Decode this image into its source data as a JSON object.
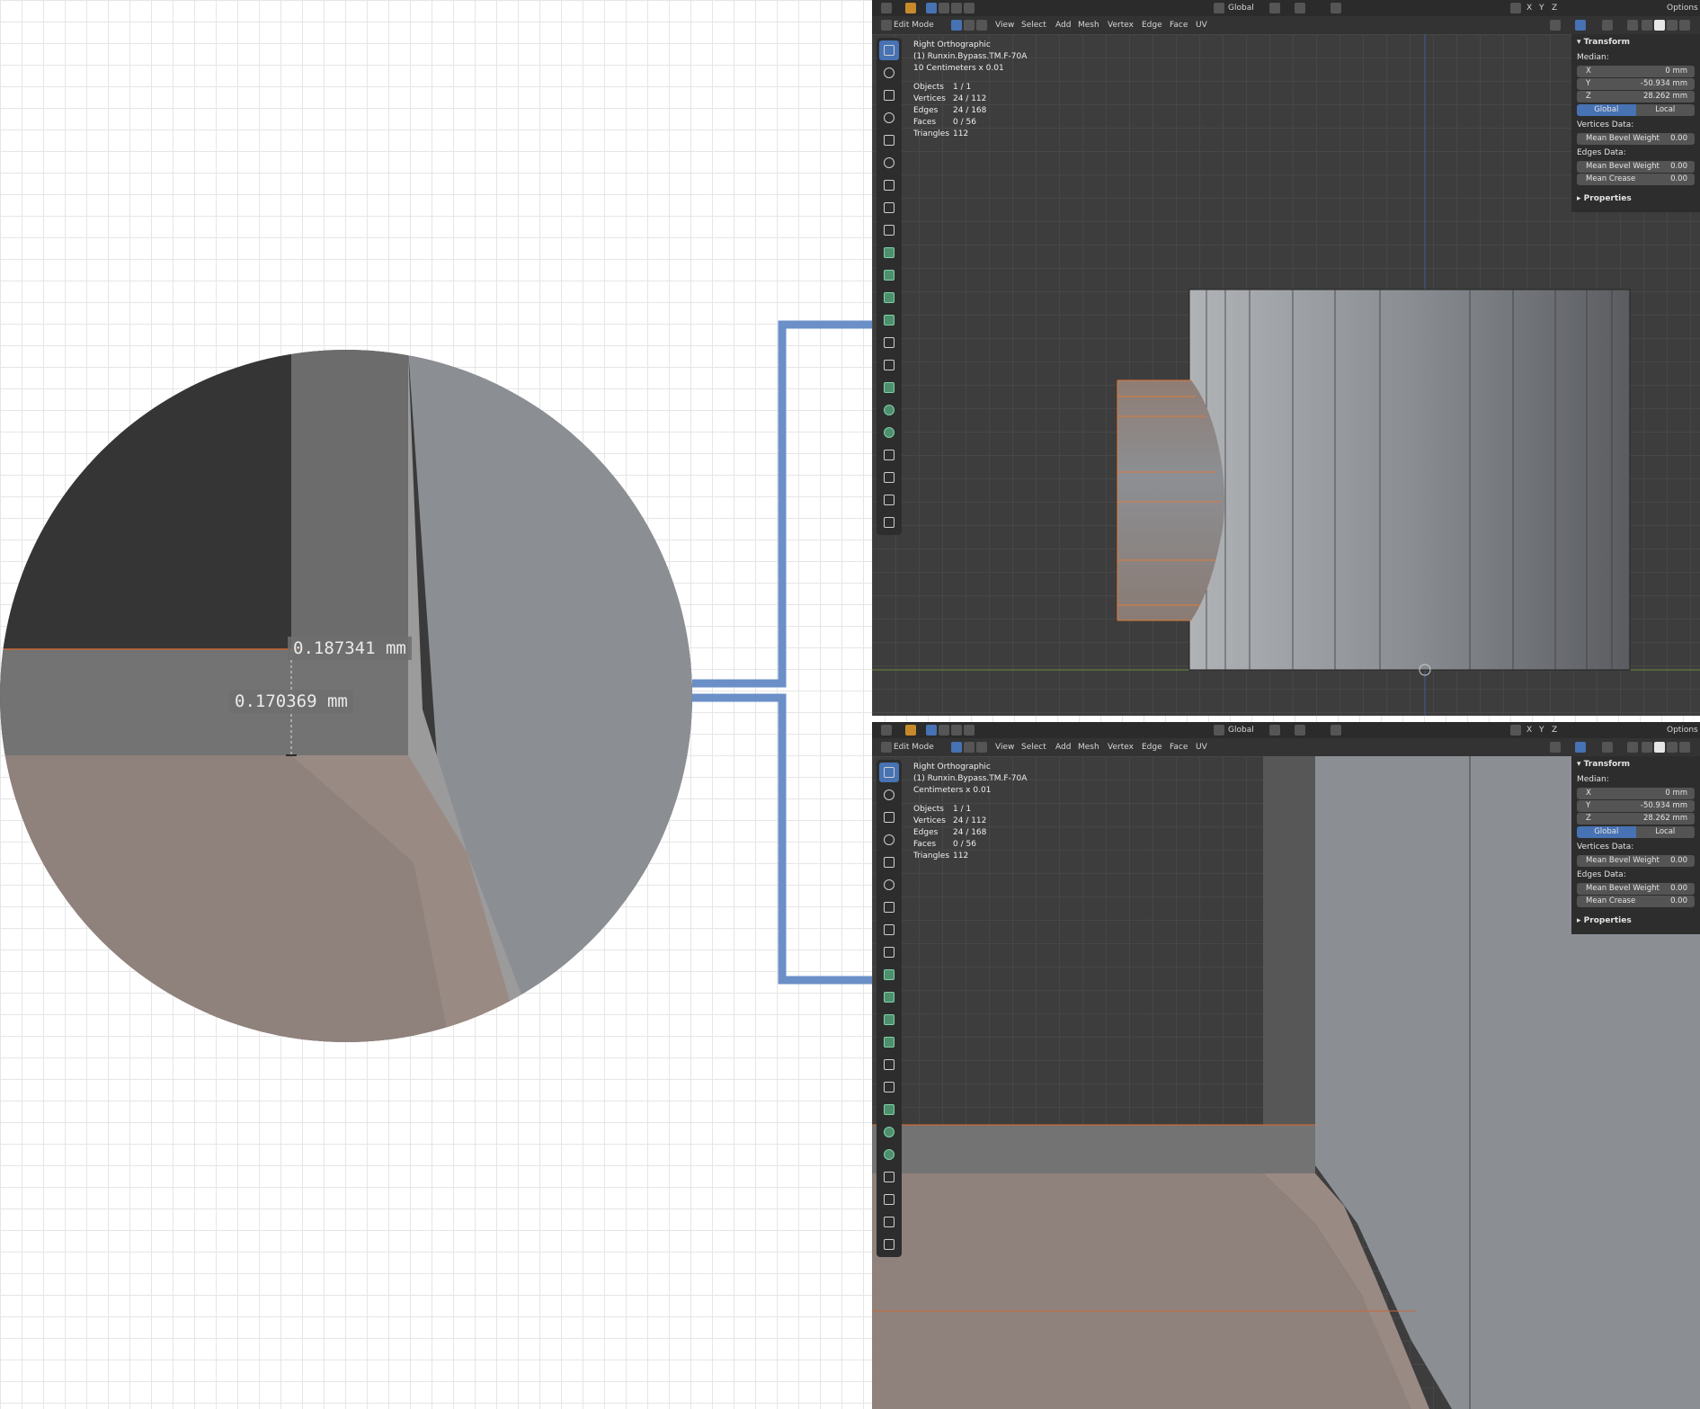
{
  "zoom": {
    "measure_a": "0.187341 mm",
    "measure_b": "0.170369 mm"
  },
  "blender": {
    "header_top": {
      "orientation": "Global",
      "axes": [
        "X",
        "Y",
        "Z"
      ],
      "options_label": "Options"
    },
    "header_menu": {
      "mode": "Edit Mode",
      "menus": [
        "View",
        "Select",
        "Add",
        "Mesh",
        "Vertex",
        "Edge",
        "Face",
        "UV"
      ]
    },
    "overlay": {
      "view_name": "Right Orthographic",
      "object_name": "(1) Runxin.Bypass.TM.F-70A",
      "scale_top": "10 Centimeters x 0.01",
      "scale_bottom": "Centimeters x 0.01",
      "stats": [
        {
          "label": "Objects",
          "value": "1 / 1"
        },
        {
          "label": "Vertices",
          "value": "24 / 112"
        },
        {
          "label": "Edges",
          "value": "24 / 168"
        },
        {
          "label": "Faces",
          "value": "0 / 56"
        },
        {
          "label": "Triangles",
          "value": "112"
        }
      ]
    },
    "npanel": {
      "transform_title": "Transform",
      "median_label": "Median:",
      "fields": [
        {
          "axis": "X",
          "value": "0 mm"
        },
        {
          "axis": "Y",
          "value": "-50.934 mm"
        },
        {
          "axis": "Z",
          "value": "28.262 mm"
        }
      ],
      "space_global": "Global",
      "space_local": "Local",
      "vertices_data_label": "Vertices Data:",
      "vertex_bevel": {
        "label": "Mean Bevel Weight",
        "value": "0.00"
      },
      "edges_data_label": "Edges Data:",
      "edge_bevel": {
        "label": "Mean Bevel Weight",
        "value": "0.00"
      },
      "edge_crease": {
        "label": "Mean Crease",
        "value": "0.00"
      },
      "properties_label": "Properties"
    }
  },
  "colors": {
    "accent_blue": "#4772b3",
    "connector_blue": "#6b8fc7",
    "mesh_gray": "#8b8f94",
    "mesh_tan": "#8f817b",
    "selected_edge": "#e07a3a"
  }
}
